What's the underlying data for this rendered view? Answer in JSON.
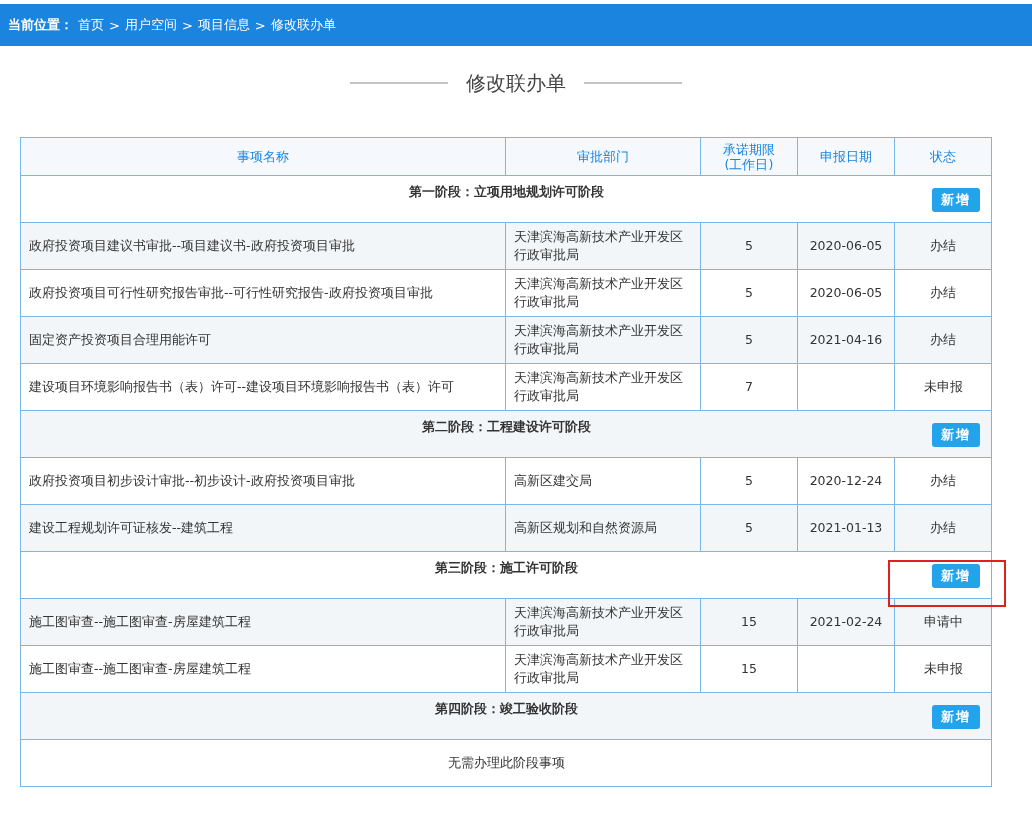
{
  "breadcrumb": {
    "label": "当前位置：",
    "separator": ">",
    "items": [
      "首页",
      "用户空间",
      "项目信息",
      "修改联办单"
    ]
  },
  "page_title": "修改联办单",
  "table": {
    "columns": [
      "事项名称",
      "审批部门",
      "承诺期限\n(工作日)",
      "申报日期",
      "状态"
    ],
    "stages": [
      {
        "title": "第一阶段：立项用地规划许可阶段",
        "button": "新增",
        "highlighted": false,
        "rows": [
          {
            "name": "政府投资项目建议书审批--项目建议书-政府投资项目审批",
            "department": "天津滨海高新技术产业开发区行政审批局",
            "days": "5",
            "date": "2020-06-05",
            "status": "办结"
          },
          {
            "name": "政府投资项目可行性研究报告审批--可行性研究报告-政府投资项目审批",
            "department": "天津滨海高新技术产业开发区行政审批局",
            "days": "5",
            "date": "2020-06-05",
            "status": "办结"
          },
          {
            "name": "固定资产投资项目合理用能许可",
            "department": "天津滨海高新技术产业开发区行政审批局",
            "days": "5",
            "date": "2021-04-16",
            "status": "办结"
          },
          {
            "name": "建设项目环境影响报告书（表）许可--建设项目环境影响报告书（表）许可",
            "department": "天津滨海高新技术产业开发区行政审批局",
            "days": "7",
            "status": "未申报"
          }
        ]
      },
      {
        "title": "第二阶段：工程建设许可阶段",
        "button": "新增",
        "highlighted": false,
        "rows": [
          {
            "name": "政府投资项目初步设计审批--初步设计-政府投资项目审批",
            "department": "高新区建交局",
            "days": "5",
            "date": "2020-12-24",
            "status": "办结"
          },
          {
            "name": "建设工程规划许可证核发--建筑工程",
            "department": "高新区规划和自然资源局",
            "days": "5",
            "date": "2021-01-13",
            "status": "办结"
          }
        ]
      },
      {
        "title": "第三阶段：施工许可阶段",
        "button": "新增",
        "highlighted": true,
        "rows": [
          {
            "name": "施工图审查--施工图审查-房屋建筑工程",
            "department": "天津滨海高新技术产业开发区行政审批局",
            "days": "15",
            "date": "2021-02-24",
            "status": "申请中"
          },
          {
            "name": "施工图审查--施工图审查-房屋建筑工程",
            "department": "天津滨海高新技术产业开发区行政审批局",
            "days": "15",
            "status": "未申报"
          }
        ]
      },
      {
        "title": "第四阶段：竣工验收阶段",
        "button": "新增",
        "highlighted": false,
        "note": "无需办理此阶段事项"
      }
    ]
  }
}
